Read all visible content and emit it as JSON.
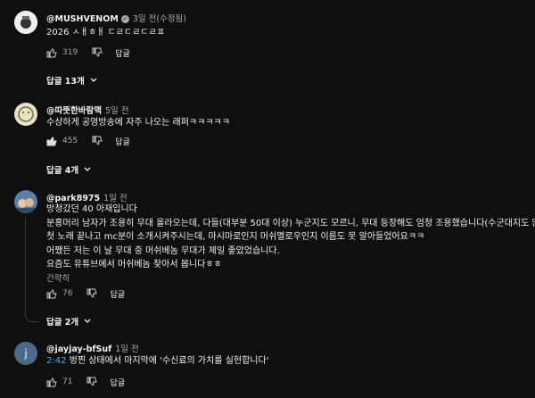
{
  "comments": [
    {
      "author": "@MUSHVENOM",
      "time": "3일 전(수정됨)",
      "lines": [
        "2026 ㅅㅐㅎㅐ ㄷㄹㄷㄹㄷㄹㅍ"
      ],
      "likes": "319",
      "reply_label": "답글",
      "replies_label": "답글 13개"
    },
    {
      "author": "@따뜻한바람맥",
      "time": "5일 전",
      "lines": [
        "수상하게 공영방송에 자주 나오는 래퍼ㅋㅋㅋㅋㅋ"
      ],
      "likes": "455",
      "reply_label": "답글",
      "replies_label": "답글 4개"
    },
    {
      "author": "@park8975",
      "time": "1일 전",
      "lines": [
        "방청갔던 40 아재입니다",
        "분홍머리 남자가 조용히 무대 올라오는데, 다들(대부분 50대 이상) 누군지도 모르니, 무대 등장해도 엄청 조용했습니다(수군대지도 않음)",
        "첫 노래 끝나고 mc분이 소개시켜주시는데, 마시마로인지 머쉬멜로우인지 이름도 못 알아들었어요ㅋㅋ",
        "어쨌든 저는 이 날 무대 중 머쉬베놈 무대가 제일 좋았었습니다.",
        "요즘도 유튜브에서 머쉬베놈 찾아서 봅니다ㅎㅎ"
      ],
      "more_label": "간략히",
      "likes": "76",
      "reply_label": "답글",
      "replies_label": "답글 2개"
    },
    {
      "author": "@jayjay-bfSuf",
      "time": "1일 전",
      "avatar_letter": "j",
      "timestamp": "2:42",
      "text": " 벙찐 상태에서 마지막에 '수신료의 가치를 실현합니다'",
      "likes": "71",
      "reply_label": "답글"
    }
  ],
  "colors": {
    "background": "#0f0f0f",
    "text": "#f1f1f1",
    "secondary": "#aaaaaa",
    "link": "#3ea6ff"
  }
}
